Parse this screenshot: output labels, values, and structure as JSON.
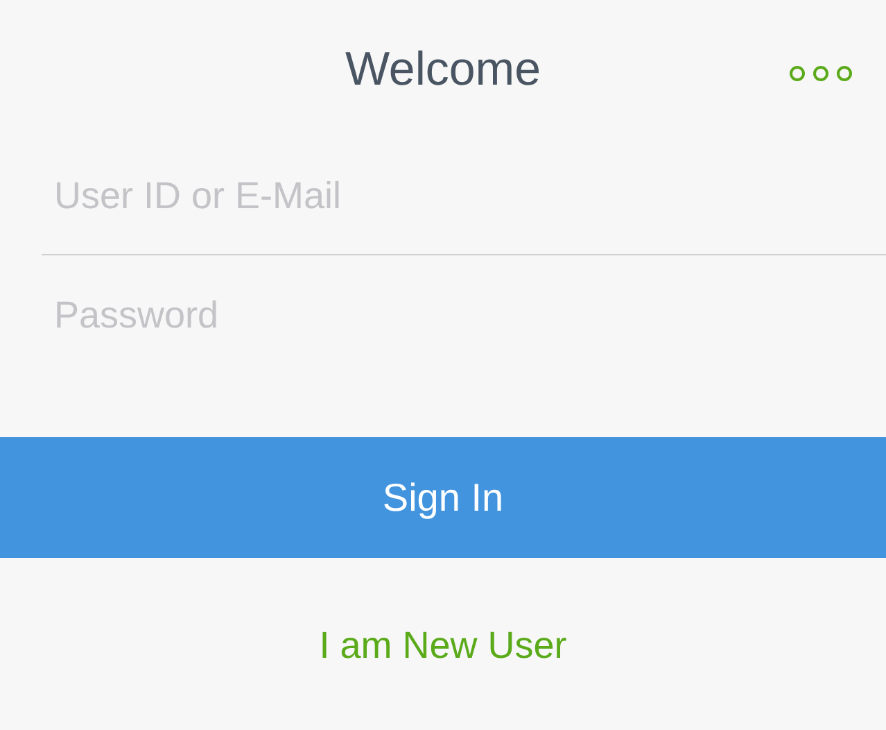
{
  "header": {
    "title": "Welcome"
  },
  "fields": [
    {
      "placeholder": "User ID or E-Mail"
    },
    {
      "placeholder": "Password"
    }
  ],
  "sign_in_button": "Sign In",
  "new_user_link": "I am New User"
}
